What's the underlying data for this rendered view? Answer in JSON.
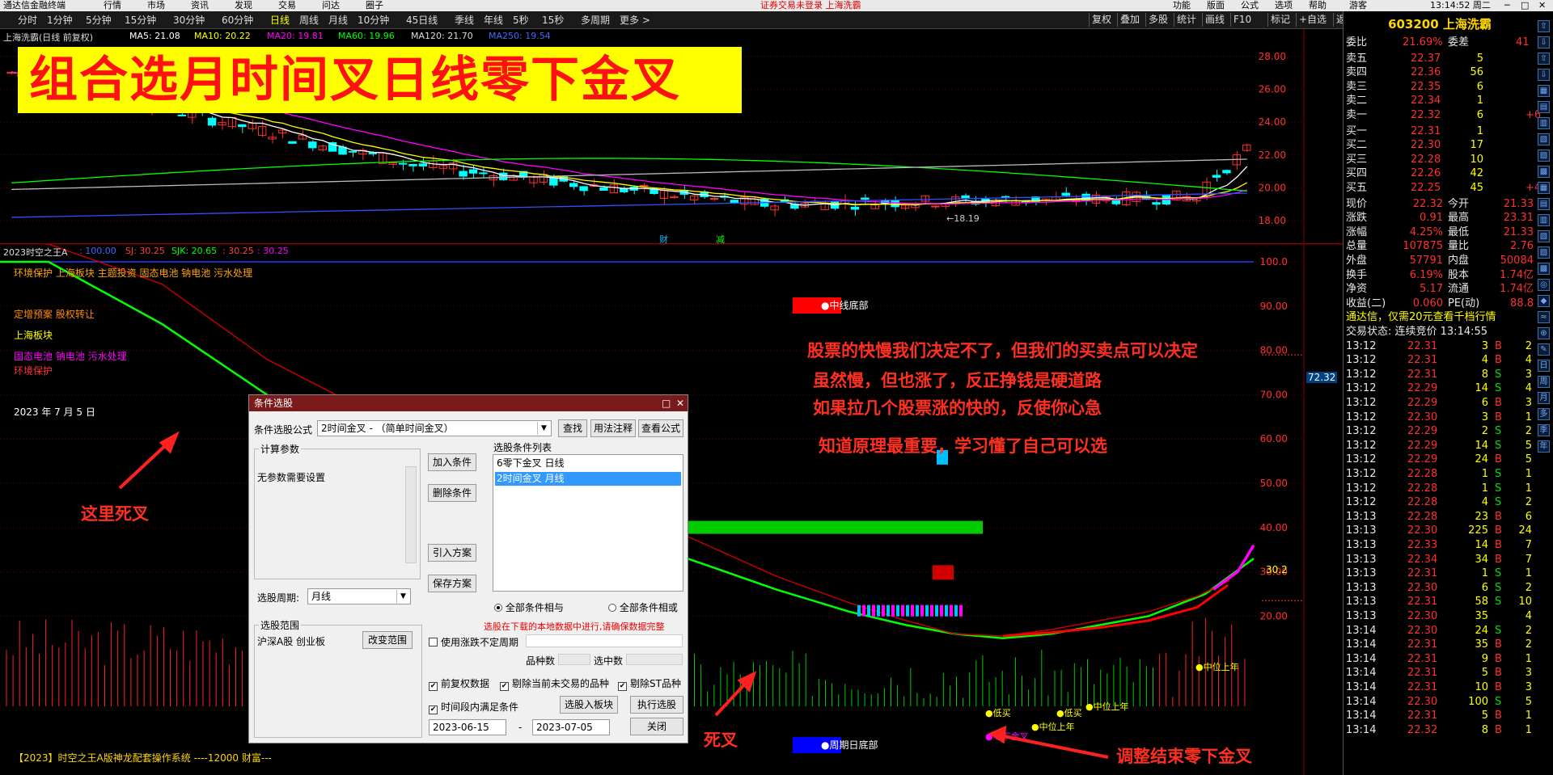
{
  "topbar": {
    "app_title": "通达信金融终端",
    "menu": [
      "行情",
      "市场",
      "资讯",
      "发现",
      "交易",
      "问达",
      "圈子"
    ],
    "center_notice": "证券交易未登录   上海洗霸",
    "right_menu": [
      "功能",
      "版面",
      "公式",
      "选项",
      "帮助"
    ],
    "user": "游客",
    "time": "13:14:52 周二"
  },
  "periods": [
    "分时",
    "1分钟",
    "5分钟",
    "15分钟",
    "30分钟",
    "60分钟",
    "日线",
    "周线",
    "月线",
    "10分钟",
    "45日线",
    "季线",
    "年线",
    "5秒",
    "15秒",
    "多周期",
    "更多 >"
  ],
  "active_period": "日线",
  "toolbar_right": [
    "复权",
    "叠加",
    "多股",
    "统计",
    "画线",
    "F10",
    "标记",
    "+自选",
    "返回"
  ],
  "kline": {
    "title": "上海洗霸(日线 前复权)",
    "ma5": "MA5: 21.08",
    "ma10": "MA10: 20.22",
    "ma20": "MA20: 19.81",
    "ma60": "MA60: 19.96",
    "ma120": "MA120: 21.70",
    "ma250": "MA250: 19.54",
    "yticks": [
      "28.00",
      "26.00",
      "24.00",
      "22.00",
      "20.00",
      "18.00"
    ],
    "low_label": "←18.19",
    "event_labels": [
      "财",
      "减"
    ]
  },
  "banner": "组合选月时间叉日线零下金叉",
  "indicator": {
    "title": "2023时空之王A",
    "params": [
      ": 100.00",
      "SJ: 30.25",
      "SJK: 20.65",
      ": 30.25",
      ": 30.25"
    ],
    "sectors": [
      "环境保护 上海板块 主题投资 固态电池 钠电池 污水处理",
      "定增预案 股权转让",
      "上海板块",
      "固态电池 钠电池 污水处理",
      "环境保护"
    ],
    "date": "2023 年 7 月 5 日",
    "yticks": [
      "100.0",
      "90.00",
      "80.00",
      "70.00",
      "60.00",
      "50.00",
      "40.00",
      "30.00",
      "20.00"
    ],
    "current": "72.32",
    "end_value": "30.2",
    "bottom_label": "●周期日底部",
    "mid_label": "●中线底部",
    "points": [
      "●低买",
      "●低买",
      "●中位上年",
      "●中位上年",
      "●零下金叉",
      "●中位上年"
    ],
    "footer": "【2023】时空之王A版神龙配套操作系统 ----12000 财富---"
  },
  "annotations": {
    "text1": "股票的快慢我们决定不了，但我们的买卖点可以决定",
    "text2": "虽然慢，但也涨了，反正挣钱是硬道路",
    "text3": "如果拉几个股票涨的快的，反使你心急",
    "text4": "知道原理最重要，学习懂了自己可以选",
    "dead_cross_1": "这里死叉",
    "dead_cross_2": "死叉",
    "end_note": "调整结束零下金叉"
  },
  "dialog": {
    "title": "条件选股",
    "formula_label": "条件选股公式",
    "formula_value": "2时间金叉   - （简单时间金叉）",
    "btn_find": "查找",
    "btn_usage": "用法注释",
    "btn_view": "查看公式",
    "param_group": "计算参数",
    "param_text": "无参数需要设置",
    "btn_add": "加入条件",
    "btn_delete": "删除条件",
    "btn_import": "引入方案",
    "btn_save": "保存方案",
    "list_label": "选股条件列表",
    "list_items": [
      "6零下金叉  日线",
      "2时间金叉  月线"
    ],
    "period_label": "选股周期:",
    "period_value": "月线",
    "radio_and": "全部条件相与",
    "radio_or": "全部条件相或",
    "warning": "选股在下载的本地数据中进行,请确保数据完整",
    "range_group": "选股范围",
    "range_value": "沪深A股 创业板",
    "btn_range": "改变范围",
    "use_period": "使用涨跌不定周期",
    "count_label": "品种数",
    "selected_label": "选中数",
    "cb_fq": "前复权数据",
    "cb_untraded": "剔除当前未交易的品种",
    "cb_st": "剔除ST品种",
    "cb_time": "时间段内满足条件",
    "btn_to_sector": "选股入板块",
    "btn_run": "执行选股",
    "date_from": "2023-06-15",
    "date_to": "2023-07-05",
    "btn_close": "关闭"
  },
  "quote": {
    "code_name": "603200 上海洗霸",
    "weibi_label": "委比",
    "weibi": "21.69%",
    "weicha_label": "委差",
    "weicha": "41",
    "sells": [
      {
        "label": "卖五",
        "price": "22.37",
        "vol": "5"
      },
      {
        "label": "卖四",
        "price": "22.36",
        "vol": "56"
      },
      {
        "label": "卖三",
        "price": "22.35",
        "vol": "6"
      },
      {
        "label": "卖二",
        "price": "22.34",
        "vol": "1"
      },
      {
        "label": "卖一",
        "price": "22.32",
        "vol": "6",
        "chg": "+6"
      }
    ],
    "buys": [
      {
        "label": "买一",
        "price": "22.31",
        "vol": "1"
      },
      {
        "label": "买二",
        "price": "22.30",
        "vol": "17"
      },
      {
        "label": "买三",
        "price": "22.28",
        "vol": "10"
      },
      {
        "label": "买四",
        "price": "22.26",
        "vol": "42"
      },
      {
        "label": "买五",
        "price": "22.25",
        "vol": "45",
        "chg": "+45"
      }
    ],
    "stats": [
      [
        "现价",
        "22.32",
        "今开",
        "21.33"
      ],
      [
        "涨跌",
        "0.91",
        "最高",
        "23.31"
      ],
      [
        "涨幅",
        "4.25%",
        "最低",
        "21.33"
      ],
      [
        "总量",
        "107875",
        "量比",
        "2.76"
      ],
      [
        "外盘",
        "57791",
        "内盘",
        "50084"
      ],
      [
        "换手",
        "6.19%",
        "股本",
        "1.74亿"
      ],
      [
        "净资",
        "5.17",
        "流通",
        "1.74亿"
      ],
      [
        "收益(二)",
        "0.060",
        "PE(动)",
        "88.8"
      ]
    ],
    "promo": "通达信，仅需20元查看千档行情",
    "trade_status": "交易状态: 连续竞价 13:14:55",
    "ticks": [
      [
        "13:12",
        "22.31",
        "3",
        "B",
        "2"
      ],
      [
        "13:12",
        "22.31",
        "4",
        "B",
        "4"
      ],
      [
        "13:12",
        "22.31",
        "8",
        "S",
        "3"
      ],
      [
        "13:12",
        "22.29",
        "14",
        "S",
        "4"
      ],
      [
        "13:12",
        "22.29",
        "6",
        "B",
        "3"
      ],
      [
        "13:12",
        "22.30",
        "3",
        "B",
        "1"
      ],
      [
        "13:12",
        "22.29",
        "2",
        "S",
        "2"
      ],
      [
        "13:12",
        "22.29",
        "14",
        "S",
        "5"
      ],
      [
        "13:12",
        "22.29",
        "24",
        "B",
        "5"
      ],
      [
        "13:12",
        "22.28",
        "1",
        "S",
        "1"
      ],
      [
        "13:12",
        "22.28",
        "1",
        "S",
        "1"
      ],
      [
        "13:12",
        "22.28",
        "4",
        "S",
        "2"
      ],
      [
        "13:13",
        "22.28",
        "23",
        "B",
        "6"
      ],
      [
        "13:13",
        "22.30",
        "225",
        "B",
        "24"
      ],
      [
        "13:13",
        "22.33",
        "14",
        "B",
        "7"
      ],
      [
        "13:13",
        "22.34",
        "34",
        "B",
        "7"
      ],
      [
        "13:13",
        "22.31",
        "1",
        "S",
        "1"
      ],
      [
        "13:13",
        "22.30",
        "6",
        "S",
        "2"
      ],
      [
        "13:13",
        "22.31",
        "58",
        "S",
        "10"
      ],
      [
        "13:13",
        "22.30",
        "35",
        "",
        "4"
      ],
      [
        "13:14",
        "22.30",
        "24",
        "S",
        "2"
      ],
      [
        "13:14",
        "22.31",
        "35",
        "B",
        "2"
      ],
      [
        "13:14",
        "22.31",
        "9",
        "B",
        "1"
      ],
      [
        "13:14",
        "22.31",
        "5",
        "B",
        "3"
      ],
      [
        "13:14",
        "22.31",
        "10",
        "B",
        "3"
      ],
      [
        "13:14",
        "22.30",
        "100",
        "S",
        "5"
      ],
      [
        "13:14",
        "22.31",
        "5",
        "B",
        "1"
      ],
      [
        "13:14",
        "22.32",
        "8",
        "B",
        "1"
      ]
    ],
    "side_icons": [
      "日",
      "周",
      "月",
      "多",
      "季",
      "年"
    ]
  },
  "colors": {
    "up": "#ff3030",
    "down": "#00ffff",
    "banner_bg": "#ffff00",
    "banner_fg": "#ff1111",
    "annotation": "#ff3020"
  }
}
